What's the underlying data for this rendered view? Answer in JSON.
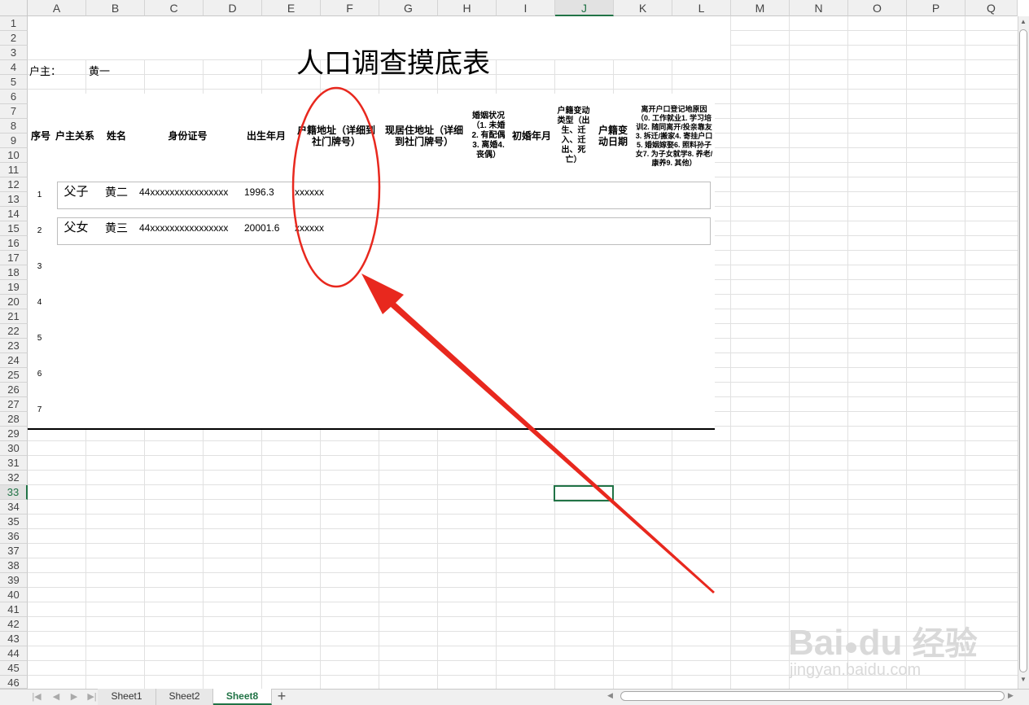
{
  "columns": [
    "A",
    "B",
    "C",
    "D",
    "E",
    "F",
    "G",
    "H",
    "I",
    "J",
    "K",
    "L",
    "M",
    "N",
    "O",
    "P",
    "Q"
  ],
  "selected_column": "J",
  "rows": [
    "1",
    "2",
    "3",
    "4",
    "5",
    "6",
    "7",
    "8",
    "9",
    "10",
    "11",
    "12",
    "13",
    "14",
    "15",
    "16",
    "17",
    "18",
    "19",
    "20",
    "21",
    "22",
    "23",
    "24",
    "25",
    "26",
    "27",
    "28",
    "29",
    "30",
    "31",
    "32",
    "33",
    "34",
    "35",
    "36",
    "37",
    "38",
    "39",
    "40",
    "41",
    "42",
    "43",
    "44",
    "45",
    "46"
  ],
  "selected_row": "33",
  "sheet": {
    "title": "人口调查摸底表",
    "householder_label": "户主：",
    "householder_name": "黄一"
  },
  "table": {
    "headers": {
      "seq": "序号",
      "relation": "户主关系",
      "name": "姓名",
      "id_number": "身份证号",
      "birth": "出生年月",
      "reg_address": "户籍地址（详细到社门牌号）",
      "cur_address": "现居住地址（详细到社门牌号）",
      "marital": "婚姻状况（1. 未婚2. 有配偶3. 离婚4. 丧偶）",
      "first_marriage": "初婚年月",
      "change_type": "户籍变动类型（出生、迁入、迁出、死亡）",
      "change_date": "户籍变动日期",
      "leave_reason": "离开户口登记地原因（0. 工作就业1. 学习培训2. 随同离开/投亲靠友3. 拆迁/搬家4. 寄挂户口5. 婚姻嫁娶6. 照料孙子女7. 为子女就学8. 养老/康养9. 其他）"
    },
    "rows": [
      {
        "seq": "1",
        "relation": "父子",
        "name": "黄二",
        "id_number": "44xxxxxxxxxxxxxxxx",
        "birth": "1996.3",
        "reg_address": "xxxxxx"
      },
      {
        "seq": "2",
        "relation": "父女",
        "name": "黄三",
        "id_number": "44xxxxxxxxxxxxxxxx",
        "birth": "20001.6",
        "reg_address": "xxxxxx"
      },
      {
        "seq": "3"
      },
      {
        "seq": "4"
      },
      {
        "seq": "5"
      },
      {
        "seq": "6"
      },
      {
        "seq": "7"
      }
    ]
  },
  "tabs": [
    "Sheet1",
    "Sheet2",
    "Sheet8"
  ],
  "active_tab": "Sheet8",
  "add_tab_glyph": "+",
  "annotation_color": "#e8281e",
  "watermark": {
    "brand": "Bai",
    "brand2": "du",
    "cn": "经验",
    "url": "jingyan.baidu.com"
  }
}
